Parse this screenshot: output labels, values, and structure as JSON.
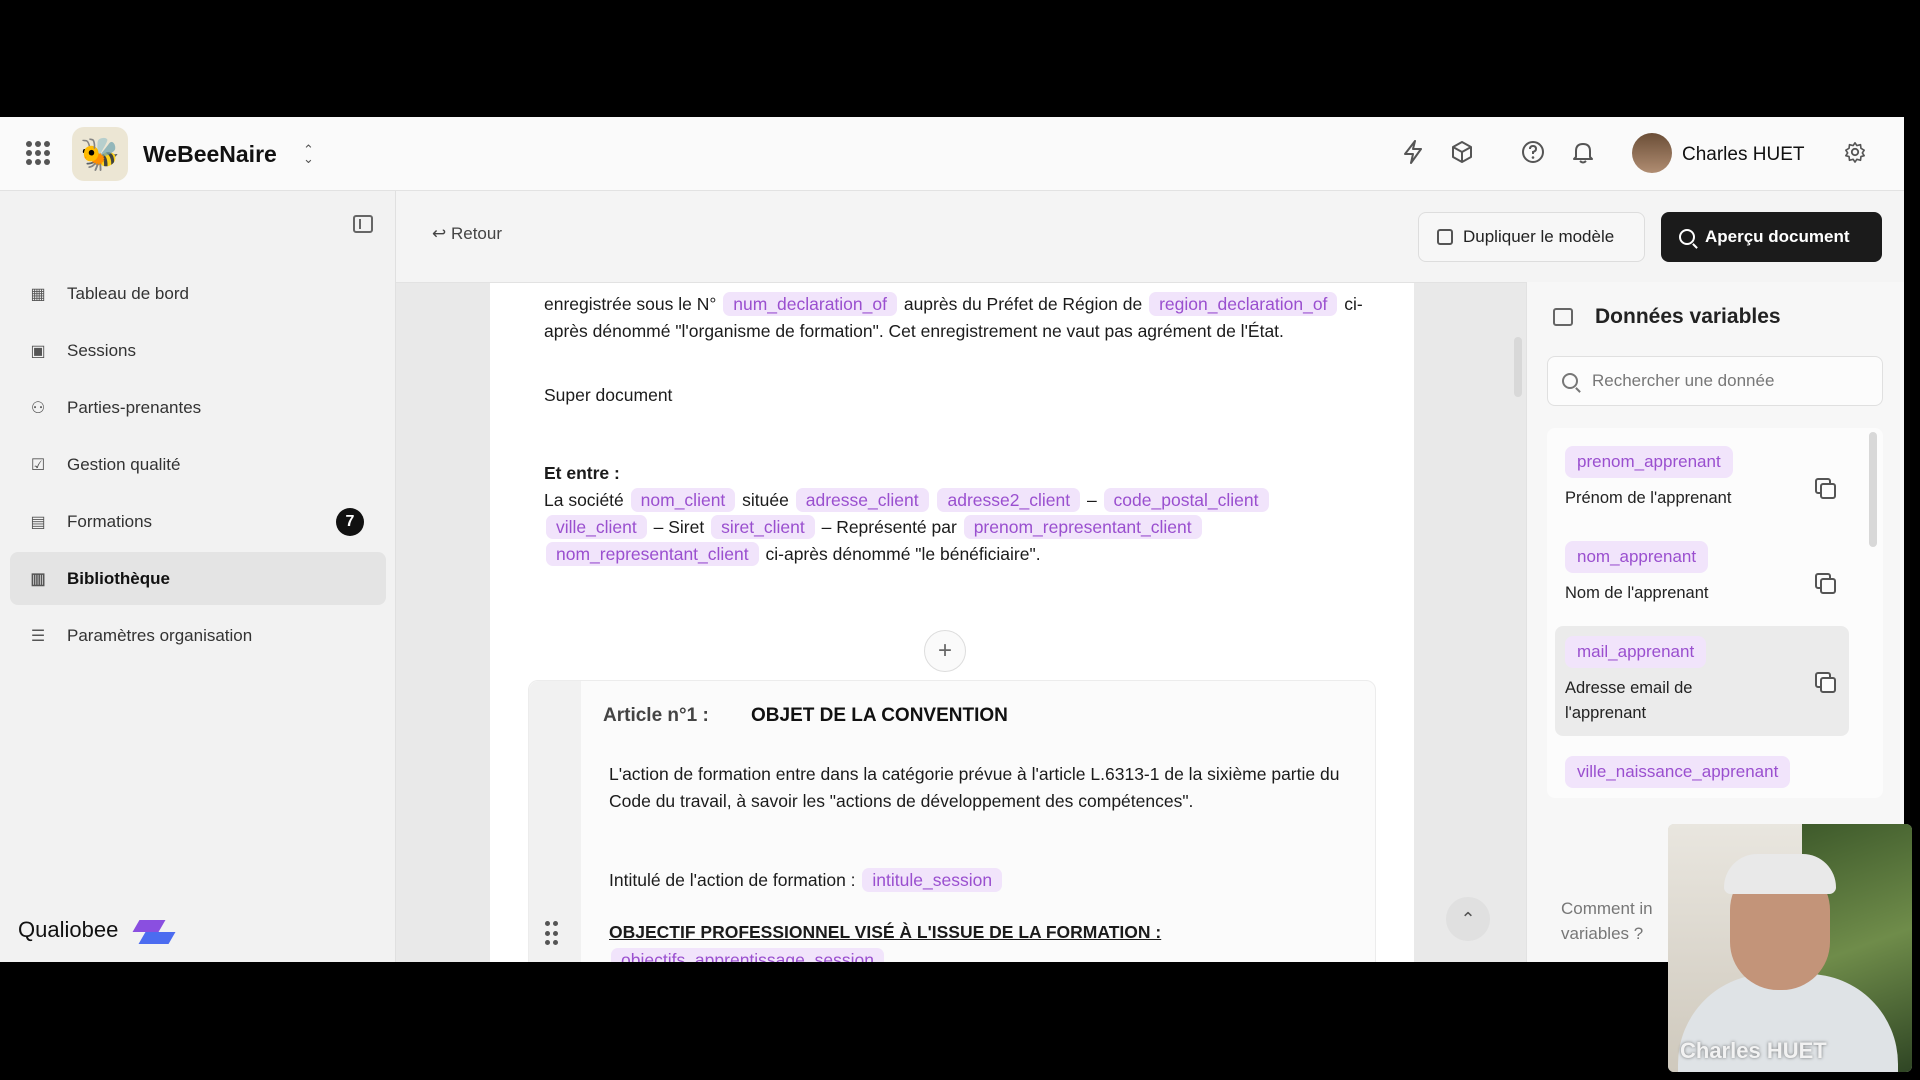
{
  "topbar": {
    "org_name": "WeBeeNaire",
    "user_name": "Charles HUET"
  },
  "sidebar": {
    "items": [
      {
        "label": "Tableau de bord",
        "icon": "dashboard-icon"
      },
      {
        "label": "Sessions",
        "icon": "sessions-icon"
      },
      {
        "label": "Parties-prenantes",
        "icon": "people-icon"
      },
      {
        "label": "Gestion qualité",
        "icon": "checkbox-icon"
      },
      {
        "label": "Formations",
        "icon": "book-icon",
        "badge": "7"
      },
      {
        "label": "Bibliothèque",
        "icon": "library-icon",
        "active": true
      },
      {
        "label": "Paramètres organisation",
        "icon": "sliders-icon"
      }
    ],
    "brand": "Qualiobee"
  },
  "toolbar": {
    "back_label": "Retour",
    "duplicate_label": "Dupliquer le modèle",
    "preview_label": "Aperçu document"
  },
  "document": {
    "p1": {
      "t1": "enregistrée sous le N°",
      "v1": "num_declaration_of",
      "t2": "auprès du Préfet de Région de",
      "v2": "region_declaration_of",
      "t3": "ci-après dénommé \"l'organisme de formation\". Cet enregistrement ne vaut pas agrément de l'État."
    },
    "p2": "Super document",
    "p3": {
      "heading": "Et entre :",
      "t1": "La société",
      "v1": "nom_client",
      "t2": "située",
      "v2": "adresse_client",
      "v3": "adresse2_client",
      "t3": "–",
      "v4": "code_postal_client",
      "v5": "ville_client",
      "t4": "– Siret",
      "v6": "siret_client",
      "t5": "– Représenté par",
      "v7": "prenom_representant_client",
      "v8": "nom_representant_client",
      "t6": "ci-après dénommé \"le bénéficiaire\"."
    },
    "article": {
      "label": "Article n°1 :",
      "title": "OBJET DE LA CONVENTION",
      "p1": "L'action de formation entre dans la catégorie prévue à l'article L.6313-1 de la sixième partie du Code du travail, à savoir les \"actions de développement des compétences\".",
      "p2_text": "Intitulé de l'action de formation :",
      "p2_var": "intitule_session",
      "p3": "OBJECTIF PROFESSIONNEL VISÉ À L'ISSUE DE LA FORMATION :",
      "p4_var": "objectifs_apprentissage_session"
    }
  },
  "panel": {
    "title": "Données variables",
    "search_placeholder": "Rechercher une donnée",
    "variables": [
      {
        "name": "prenom_apprenant",
        "desc": "Prénom de l'apprenant"
      },
      {
        "name": "nom_apprenant",
        "desc": "Nom de l'apprenant"
      },
      {
        "name": "mail_apprenant",
        "desc": "Adresse email de l'apprenant"
      },
      {
        "name": "ville_naissance_apprenant",
        "desc": ""
      }
    ],
    "help_text": "Comment in variables ?"
  },
  "webcam": {
    "name": "Charles HUET"
  },
  "colors": {
    "chip_bg": "#f1e4fb",
    "chip_text": "#9a4fcf",
    "primary_button": "#1b1b1b",
    "badge": "#111111"
  }
}
